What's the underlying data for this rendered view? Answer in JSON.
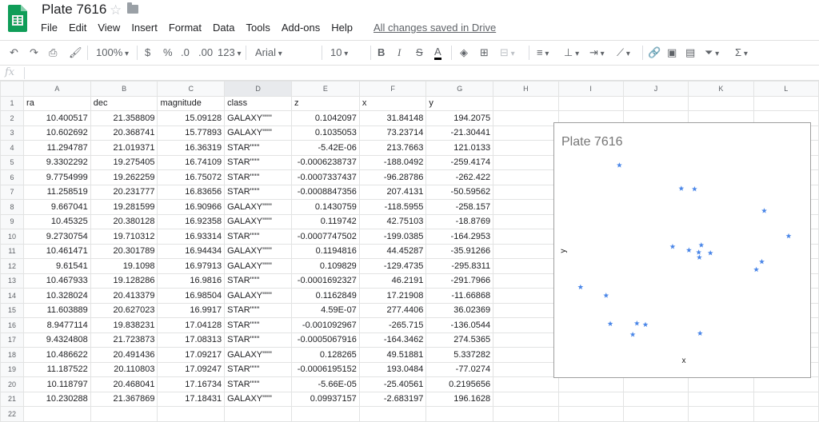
{
  "header": {
    "title": "Plate 7616",
    "menus": [
      "File",
      "Edit",
      "View",
      "Insert",
      "Format",
      "Data",
      "Tools",
      "Add-ons",
      "Help"
    ],
    "saved_status": "All changes saved in Drive"
  },
  "toolbar": {
    "zoom": "100%",
    "currency": "$",
    "percent": "%",
    "dec_decrease": ".0",
    "dec_increase": ".00",
    "more_formats": "123",
    "font": "Arial",
    "font_size": "10",
    "bold": "B",
    "italic": "I",
    "strike": "S",
    "text_color": "A",
    "sum": "Σ"
  },
  "formula_bar": {
    "fx": "fx",
    "value": ""
  },
  "columns": [
    "A",
    "B",
    "C",
    "D",
    "E",
    "F",
    "G",
    "H",
    "I",
    "J",
    "K",
    "L"
  ],
  "rows": [
    [
      "ra",
      "dec",
      "magnitude",
      "class",
      "z",
      "x",
      "y"
    ],
    [
      "10.400517",
      "21.358809",
      "15.09128",
      "GALAXY\"\"\"",
      "0.1042097",
      "31.84148",
      "194.2075"
    ],
    [
      "10.602692",
      "20.368741",
      "15.77893",
      "GALAXY\"\"\"",
      "0.1035053",
      "73.23714",
      "-21.30441"
    ],
    [
      "11.294787",
      "21.019371",
      "16.36319",
      "STAR\"\"\"",
      "-5.42E-06",
      "213.7663",
      "121.0133"
    ],
    [
      "9.3302292",
      "19.275405",
      "16.74109",
      "STAR\"\"\"",
      "-0.0006238737",
      "-188.0492",
      "-259.4174"
    ],
    [
      "9.7754999",
      "19.262259",
      "16.75072",
      "STAR\"\"\"",
      "-0.0007337437",
      "-96.28786",
      "-262.422"
    ],
    [
      "11.258519",
      "20.231777",
      "16.83656",
      "STAR\"\"\"",
      "-0.0008847356",
      "207.4131",
      "-50.59562"
    ],
    [
      "9.667041",
      "19.281599",
      "16.90966",
      "GALAXY\"\"\"",
      "0.1430759",
      "-118.5955",
      "-258.157"
    ],
    [
      "10.45325",
      "20.380128",
      "16.92358",
      "GALAXY\"\"\"",
      "0.119742",
      "42.75103",
      "-18.8769"
    ],
    [
      "9.2730754",
      "19.710312",
      "16.93314",
      "STAR\"\"\"",
      "-0.0007747502",
      "-199.0385",
      "-164.2953"
    ],
    [
      "10.461471",
      "20.301789",
      "16.94434",
      "GALAXY\"\"\"",
      "0.1194816",
      "44.45287",
      "-35.91266"
    ],
    [
      "9.61541",
      "19.1098",
      "16.97913",
      "GALAXY\"\"\"",
      "0.109829",
      "-129.4735",
      "-295.8311"
    ],
    [
      "10.467933",
      "19.128286",
      "16.9816",
      "STAR\"\"\"",
      "-0.0001692327",
      "46.2191",
      "-291.7966"
    ],
    [
      "10.328024",
      "20.413379",
      "16.98504",
      "GALAXY\"\"\"",
      "0.1162849",
      "17.21908",
      "-11.66868"
    ],
    [
      "11.603889",
      "20.627023",
      "16.9917",
      "STAR\"\"\"",
      "4.59E-07",
      "277.4406",
      "36.02369"
    ],
    [
      "8.9477114",
      "19.838231",
      "17.04128",
      "STAR\"\"\"",
      "-0.001092967",
      "-265.715",
      "-136.0544"
    ],
    [
      "9.4324808",
      "21.723873",
      "17.08313",
      "STAR\"\"\"",
      "-0.0005067916",
      "-164.3462",
      "274.5365"
    ],
    [
      "10.486622",
      "20.491436",
      "17.09217",
      "GALAXY\"\"\"",
      "0.128265",
      "49.51881",
      "5.337282"
    ],
    [
      "11.187522",
      "20.110803",
      "17.09247",
      "STAR\"\"\"",
      "-0.0006195152",
      "193.0484",
      "-77.0274"
    ],
    [
      "10.118797",
      "20.468041",
      "17.16734",
      "STAR\"\"\"",
      "-5.66E-05",
      "-25.40561",
      "0.2195656"
    ],
    [
      "10.230288",
      "21.367869",
      "17.18431",
      "GALAXY\"\"\"",
      "0.09937157",
      "-2.683197",
      "196.1628"
    ],
    []
  ],
  "chart_data": {
    "type": "scatter",
    "title": "Plate 7616",
    "xlabel": "x",
    "ylabel": "y",
    "marker": "star",
    "color": "#4a86e8",
    "xlim": [
      -280,
      292
    ],
    "ylim": [
      -305,
      298
    ],
    "x": [
      31.84148,
      73.23714,
      213.7663,
      -188.0492,
      -96.28786,
      207.4131,
      -118.5955,
      42.75103,
      -199.0385,
      44.45287,
      -129.4735,
      46.2191,
      17.21908,
      277.4406,
      -265.715,
      -164.3462,
      49.51881,
      193.0484,
      -25.40561,
      -2.683197
    ],
    "y": [
      194.2075,
      -21.30441,
      121.0133,
      -259.4174,
      -262.422,
      -50.59562,
      -258.157,
      -18.8769,
      -164.2953,
      -35.91266,
      -295.8311,
      -291.7966,
      -11.66868,
      36.02369,
      -136.0544,
      274.5365,
      5.337282,
      -77.0274,
      0.2195656,
      196.1628
    ]
  }
}
